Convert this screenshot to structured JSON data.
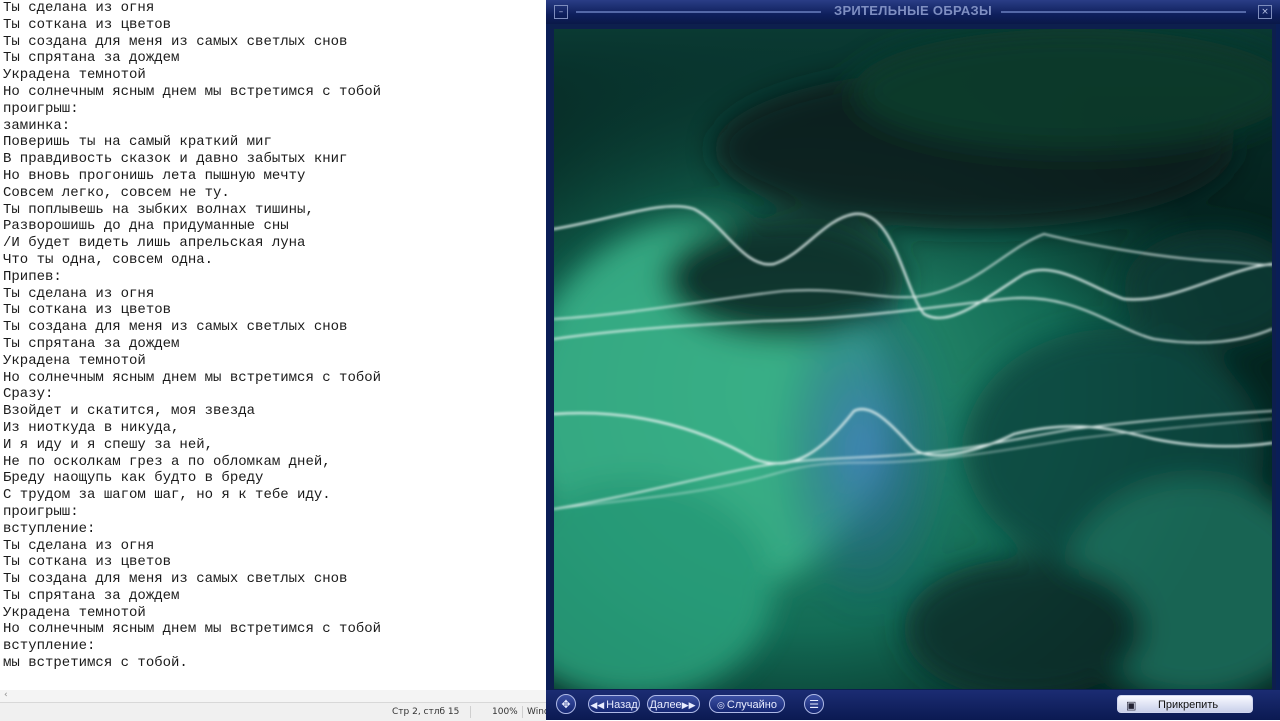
{
  "notepad": {
    "lines": [
      "Ты сделана из огня",
      "Ты соткана из цветов",
      "Ты создана для меня из самых светлых снов",
      "Ты спрятана за дождем",
      "Украдена темнотой",
      "Но солнечным ясным днем мы встретимся с тобой",
      "проигрыш:",
      "заминка:",
      "Поверишь ты на самый краткий миг",
      "В правдивость сказок и давно забытых книг",
      "Но вновь прогонишь лета пышную мечту",
      "Совсем легко, совсем не ту.",
      "Ты поплывешь на зыбких волнах тишины,",
      "Разворошишь до дна придуманные сны",
      "/И будет видеть лишь апрельская луна",
      "Что ты одна, совсем одна.",
      "Припев:",
      "Ты сделана из огня",
      "Ты соткана из цветов",
      "Ты создана для меня из самых светлых снов",
      "Ты спрятана за дождем",
      "Украдена темнотой",
      "Но солнечным ясным днем мы встретимся с тобой",
      "Сразу:",
      "Взойдет и скатится, моя звезда",
      "Из ниоткуда в никуда,",
      "И я иду и я спешу за ней,",
      "Не по осколкам грез а по обломкам дней,",
      "Бреду наощупь как будто в бреду",
      "С трудом за шагом шаг, но я к тебе иду.",
      "проигрыш:",
      "вступление:",
      "Ты сделана из огня",
      "Ты соткана из цветов",
      "Ты создана для меня из самых светлых снов",
      "Ты спрятана за дождем",
      "Украдена темнотой",
      "Но солнечным ясным днем мы встретимся с тобой",
      "вступление:",
      "мы встретимся с тобой."
    ],
    "status": {
      "position": "Стр 2, стлб 15",
      "zoom": "100%",
      "line_ending": "Wind"
    }
  },
  "visualizer": {
    "title": "ЗРИТЕЛЬНЫЕ ОБРАЗЫ",
    "buttons": {
      "back": "Назад",
      "next": "Далее",
      "random": "Случайно",
      "pin": "Прикрепить"
    },
    "icons": {
      "minimize": "minimize-icon",
      "close": "close-icon",
      "fullscreen": "fullscreen-icon",
      "menu": "menu-icon",
      "pin": "pin-icon"
    },
    "colors": {
      "frame": "#0a1e57",
      "accent": "#2c8f6a"
    }
  }
}
